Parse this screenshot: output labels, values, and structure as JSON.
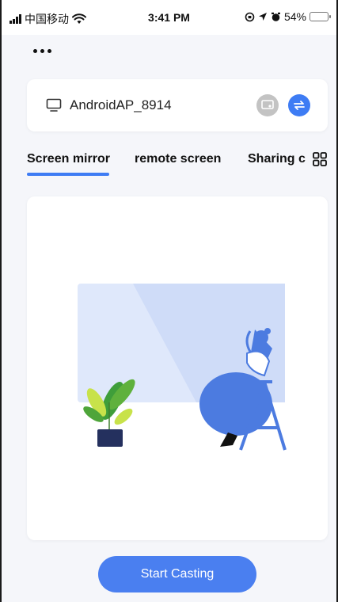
{
  "status_bar": {
    "carrier": "中国移动",
    "time": "3:41 PM",
    "battery": "54%",
    "battery_level": 0.54
  },
  "header": {
    "more_icon": "more-dots-icon"
  },
  "device": {
    "name": "AndroidAP_8914",
    "icons": [
      "monitor-icon",
      "cast-badge-icon",
      "switch-icon"
    ]
  },
  "tabs": [
    {
      "label": "Screen mirror",
      "active": true
    },
    {
      "label": "remote screen",
      "active": false
    },
    {
      "label": "Sharing c",
      "active": false
    }
  ],
  "tabs_menu_icon": "grid-icon",
  "illustration": "casting-illustration",
  "actions": {
    "start_label": "Start Casting"
  },
  "colors": {
    "accent": "#3e7cf4",
    "button": "#4a7ff0",
    "background": "#f5f6fa",
    "illustration_screen": "#dfe8fb"
  }
}
